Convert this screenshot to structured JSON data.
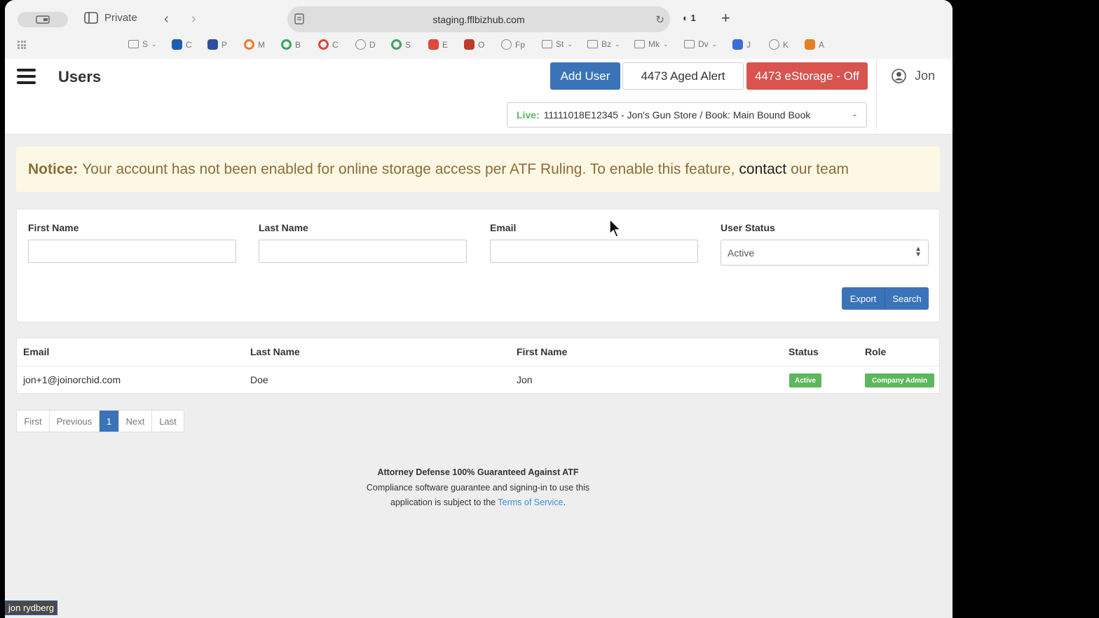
{
  "browser": {
    "private_label": "Private",
    "url": "staging.fflbizhub.com",
    "shield_count": "1",
    "bookmarks": [
      {
        "label": "S",
        "icon": "folder-icon",
        "chevron": true,
        "color": "#888888"
      },
      {
        "label": "C",
        "icon": "chase-icon",
        "chevron": false,
        "color": "#1d5fb4"
      },
      {
        "label": "P",
        "icon": "p-app-icon",
        "chevron": false,
        "color": "#2b4fa3"
      },
      {
        "label": "M",
        "icon": "m-ring-icon",
        "chevron": false,
        "color": "#f07c2a"
      },
      {
        "label": "B",
        "icon": "b-ring-icon",
        "chevron": false,
        "color": "#3aa55c"
      },
      {
        "label": "C",
        "icon": "c-ring-icon",
        "chevron": false,
        "color": "#e0483d"
      },
      {
        "label": "D",
        "icon": "globe-icon",
        "chevron": false,
        "color": "#888888"
      },
      {
        "label": "S",
        "icon": "s-ring-icon",
        "chevron": false,
        "color": "#3aa55c"
      },
      {
        "label": "E",
        "icon": "e-app-icon",
        "chevron": false,
        "color": "#e0483d"
      },
      {
        "label": "O",
        "icon": "o-person-icon",
        "chevron": false,
        "color": "#c0392b"
      },
      {
        "label": "Fp",
        "icon": "globe-icon",
        "chevron": false,
        "color": "#888888"
      },
      {
        "label": "St",
        "icon": "folder-icon",
        "chevron": true,
        "color": "#888888"
      },
      {
        "label": "Bz",
        "icon": "folder-icon",
        "chevron": true,
        "color": "#888888"
      },
      {
        "label": "Mk",
        "icon": "folder-icon",
        "chevron": true,
        "color": "#888888"
      },
      {
        "label": "Dv",
        "icon": "folder-icon",
        "chevron": true,
        "color": "#888888"
      },
      {
        "label": "J",
        "icon": "j-app-icon",
        "chevron": false,
        "color": "#3b6fd4"
      },
      {
        "label": "K",
        "icon": "globe-icon",
        "chevron": false,
        "color": "#888888"
      },
      {
        "label": "A",
        "icon": "a-cube-icon",
        "chevron": false,
        "color": "#e67e22"
      }
    ]
  },
  "header": {
    "title": "Users",
    "add_user": "Add User",
    "aged_alert": "4473 Aged Alert",
    "estorage": "4473 eStorage - Off",
    "user_name": "Jon",
    "live_label": "Live:",
    "live_value": "11111018E12345 - Jon's Gun Store / Book: Main Bound Book"
  },
  "notice": {
    "label": "Notice:",
    "text": "Your account has not been enabled for online storage access per ATF Ruling. To enable this feature,",
    "link": "contact",
    "tail": "our team"
  },
  "filters": {
    "first_name_label": "First Name",
    "last_name_label": "Last Name",
    "email_label": "Email",
    "status_label": "User Status",
    "status_value": "Active",
    "export": "Export",
    "search": "Search"
  },
  "table": {
    "headers": [
      "Email",
      "Last Name",
      "First Name",
      "Status",
      "Role"
    ],
    "rows": [
      {
        "email": "jon+1@joinorchid.com",
        "last_name": "Doe",
        "first_name": "Jon",
        "status": "Active",
        "role": "Company Admin"
      }
    ]
  },
  "pagination": [
    "First",
    "Previous",
    "1",
    "Next",
    "Last"
  ],
  "footer": {
    "heading": "Attorney Defense 100% Guaranteed Against ATF",
    "line1": "Compliance software guarantee and signing-in to use this",
    "line2": "application is subject to the",
    "tos": "Terms of Service",
    "end": "."
  },
  "overlay": {
    "name_tag": "jon rydberg"
  },
  "colors": {
    "primary": "#3a73b8",
    "danger": "#d9534f",
    "success": "#5cb85c",
    "notice_bg": "#fcf8e3"
  }
}
